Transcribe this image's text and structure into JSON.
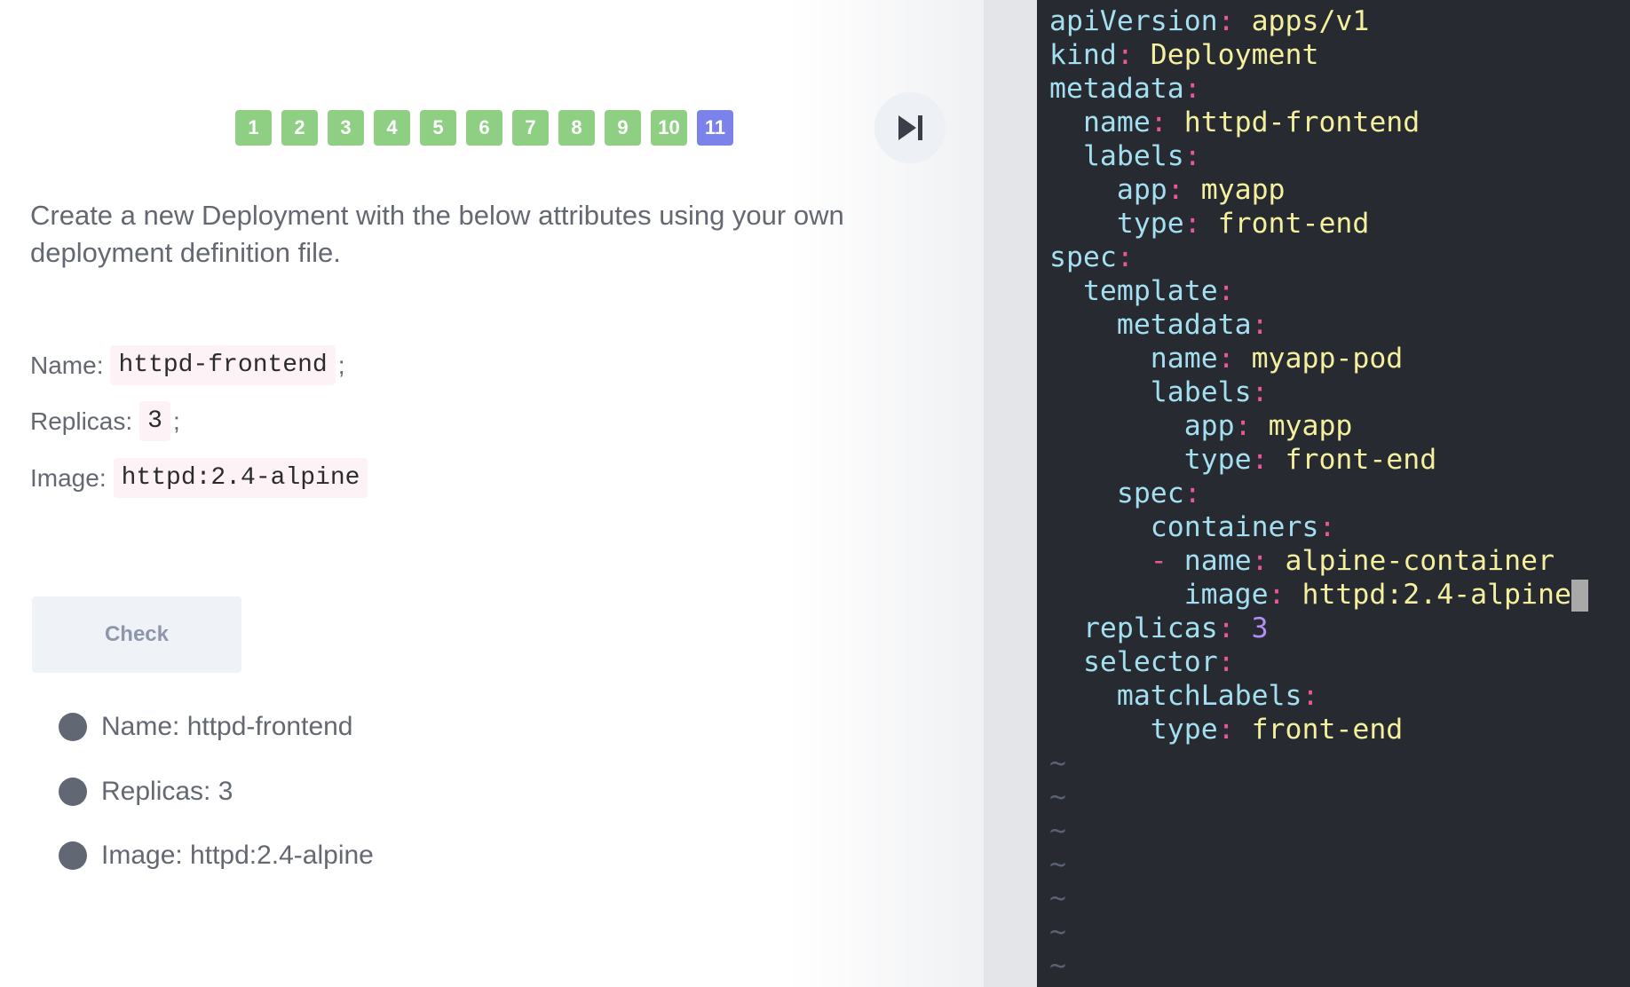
{
  "navigation": {
    "questions": [
      "1",
      "2",
      "3",
      "4",
      "5",
      "6",
      "7",
      "8",
      "9",
      "10",
      "11"
    ],
    "active_question": "11",
    "completed_color": "#8fcf84",
    "active_color": "#7b83eb",
    "skip_icon": "skip-next-icon"
  },
  "question": {
    "text": "Create a new Deployment with the below attributes using your own deployment definition file."
  },
  "attributes": {
    "name_label": "Name:",
    "name_value": "httpd-frontend",
    "name_suffix": ";",
    "replicas_label": "Replicas:",
    "replicas_value": "3",
    "replicas_suffix": ";",
    "image_label": "Image:",
    "image_value": "httpd:2.4-alpine"
  },
  "check_button": {
    "label": "Check"
  },
  "checks": [
    {
      "text": "Name: httpd-frontend"
    },
    {
      "text": "Replicas: 3"
    },
    {
      "text": "Image: httpd:2.4-alpine"
    }
  ],
  "editor": {
    "lines": [
      {
        "indent": "",
        "key": "apiVersion",
        "value": "apps/v1"
      },
      {
        "indent": "",
        "key": "kind",
        "value": "Deployment"
      },
      {
        "indent": "",
        "key": "metadata",
        "value": ""
      },
      {
        "indent": "  ",
        "key": "name",
        "value": "httpd-frontend"
      },
      {
        "indent": "  ",
        "key": "labels",
        "value": ""
      },
      {
        "indent": "    ",
        "key": "app",
        "value": "myapp"
      },
      {
        "indent": "    ",
        "key": "type",
        "value": "front-end"
      },
      {
        "indent": "",
        "key": "spec",
        "value": ""
      },
      {
        "indent": "  ",
        "key": "template",
        "value": ""
      },
      {
        "indent": "    ",
        "key": "metadata",
        "value": ""
      },
      {
        "indent": "      ",
        "key": "name",
        "value": "myapp-pod"
      },
      {
        "indent": "      ",
        "key": "labels",
        "value": ""
      },
      {
        "indent": "        ",
        "key": "app",
        "value": "myapp"
      },
      {
        "indent": "        ",
        "key": "type",
        "value": "front-end"
      },
      {
        "indent": "    ",
        "key": "spec",
        "value": ""
      },
      {
        "indent": "      ",
        "key": "containers",
        "value": ""
      },
      {
        "indent": "      ",
        "dash": "- ",
        "key": "name",
        "value": "alpine-container"
      },
      {
        "indent": "        ",
        "key": "image",
        "value": "httpd:2.4-alpine",
        "cursor": true
      },
      {
        "indent": "  ",
        "key": "replicas",
        "value": "3",
        "numeric": true
      },
      {
        "indent": "  ",
        "key": "selector",
        "value": ""
      },
      {
        "indent": "    ",
        "key": "matchLabels",
        "value": ""
      },
      {
        "indent": "      ",
        "key": "type",
        "value": "front-end"
      }
    ],
    "tilde": "~",
    "tilde_count": 7,
    "colors": {
      "background": "#272a31",
      "key": "#a3dff0",
      "punctuation": "#e8579a",
      "value": "#f4f09e",
      "number": "#b38ef3"
    }
  }
}
